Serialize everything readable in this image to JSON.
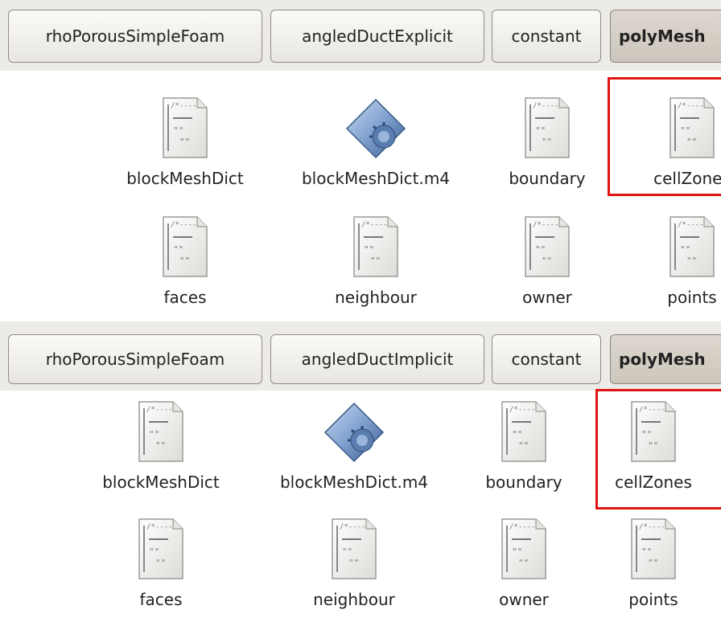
{
  "panels": [
    {
      "breadcrumbs": [
        "rhoPorousSimpleFoam",
        "angledDuctExplicit",
        "constant",
        "polyMesh"
      ],
      "files": [
        {
          "label": "blockMeshDict",
          "icon": "text-file-icon"
        },
        {
          "label": "blockMeshDict.m4",
          "icon": "script-diamond-icon"
        },
        {
          "label": "boundary",
          "icon": "text-file-icon"
        },
        {
          "label": "cellZones",
          "icon": "text-file-icon"
        },
        {
          "label": "faces",
          "icon": "text-file-icon"
        },
        {
          "label": "neighbour",
          "icon": "text-file-icon"
        },
        {
          "label": "owner",
          "icon": "text-file-icon"
        },
        {
          "label": "points",
          "icon": "text-file-icon"
        }
      ]
    },
    {
      "breadcrumbs": [
        "rhoPorousSimpleFoam",
        "angledDuctImplicit",
        "constant",
        "polyMesh"
      ],
      "files": [
        {
          "label": "blockMeshDict",
          "icon": "text-file-icon"
        },
        {
          "label": "blockMeshDict.m4",
          "icon": "script-diamond-icon"
        },
        {
          "label": "boundary",
          "icon": "text-file-icon"
        },
        {
          "label": "cellZones",
          "icon": "text-file-icon"
        },
        {
          "label": "faces",
          "icon": "text-file-icon"
        },
        {
          "label": "neighbour",
          "icon": "text-file-icon"
        },
        {
          "label": "owner",
          "icon": "text-file-icon"
        },
        {
          "label": "points",
          "icon": "text-file-icon"
        }
      ]
    }
  ],
  "colors": {
    "highlight": "#e11414",
    "pathbar": "#edebe7",
    "active_crumb": "#d3ccc2"
  }
}
